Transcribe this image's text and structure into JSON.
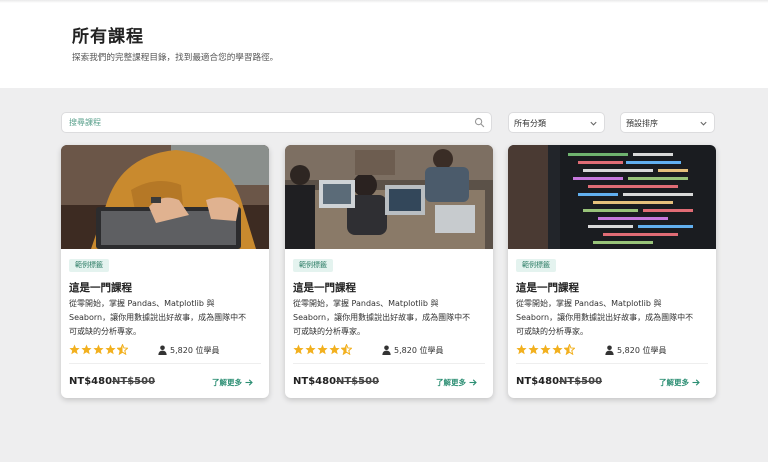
{
  "header": {
    "title": "所有課程",
    "subtitle": "探索我們的完整課程目錄，找到最適合您的學習路徑。"
  },
  "filters": {
    "search_placeholder": "搜尋課程",
    "category_value": "所有分類",
    "sort_value": "預設排序"
  },
  "courses": [
    {
      "tag": "範例標籤",
      "title": "這是一門課程",
      "desc_line1": "從零開始，掌握 Pandas、Matplotlib 與",
      "desc_line2": "Seaborn，讓你用數據說出好故事，成為團隊中不",
      "desc_line3": "可或缺的分析專家。",
      "rating": 4.5,
      "students": "5,820 位學員",
      "price": "NT$480",
      "original_price": "NT$500",
      "link": "了解更多"
    },
    {
      "tag": "範例標籤",
      "title": "這是一門課程",
      "desc_line1": "從零開始，掌握 Pandas、Matplotlib 與",
      "desc_line2": "Seaborn，讓你用數據說出好故事，成為團隊中不",
      "desc_line3": "可或缺的分析專家。",
      "rating": 4.5,
      "students": "5,820 位學員",
      "price": "NT$480",
      "original_price": "NT$500",
      "link": "了解更多"
    },
    {
      "tag": "範例標籤",
      "title": "這是一門課程",
      "desc_line1": "從零開始，掌握 Pandas、Matplotlib 與",
      "desc_line2": "Seaborn，讓你用數據說出好故事，成為團隊中不",
      "desc_line3": "可或缺的分析專家。",
      "rating": 4.5,
      "students": "5,820 位學員",
      "price": "NT$480",
      "original_price": "NT$500",
      "link": "了解更多"
    }
  ],
  "colors": {
    "accent": "#2d8f74",
    "star": "#f2b01e",
    "tag_bg": "#e4f3ef",
    "page_bg": "#eeeeef"
  },
  "icons": [
    "search-icon",
    "chevron-down-icon",
    "star-icon",
    "half-star-icon",
    "user-icon",
    "arrow-right-icon"
  ]
}
